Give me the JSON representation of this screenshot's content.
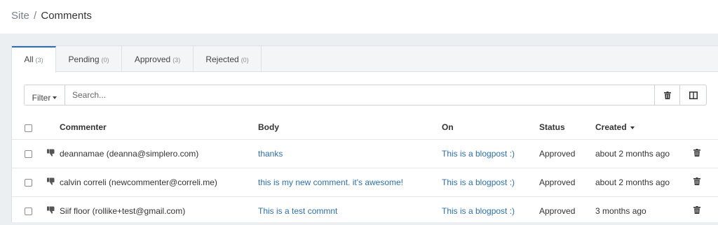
{
  "breadcrumb": {
    "site": "Site",
    "separator": "/",
    "current": "Comments"
  },
  "tabs": [
    {
      "label": "All",
      "count": "(3)",
      "active": true
    },
    {
      "label": "Pending",
      "count": "(0)",
      "active": false
    },
    {
      "label": "Approved",
      "count": "(3)",
      "active": false
    },
    {
      "label": "Rejected",
      "count": "(0)",
      "active": false
    }
  ],
  "toolbar": {
    "filter_label": "Filter",
    "search_placeholder": "Search..."
  },
  "table": {
    "headers": {
      "commenter": "Commenter",
      "body": "Body",
      "on": "On",
      "status": "Status",
      "created": "Created"
    },
    "rows": [
      {
        "commenter": "deannamae (deanna@simplero.com)",
        "body": "thanks",
        "on": "This is a blogpost :)",
        "status": "Approved",
        "created": "about 2 months ago"
      },
      {
        "commenter": "calvin correli (newcommenter@correli.me)",
        "body": "this is my new comment. it's awesome!",
        "on": "This is a blogpost :)",
        "status": "Approved",
        "created": "about 2 months ago"
      },
      {
        "commenter": "Siif floor (rollike+test@gmail.com)",
        "body": "This is a test commnt",
        "on": "This is a blogpost :)",
        "status": "Approved",
        "created": "3 months ago"
      }
    ]
  },
  "colors": {
    "link": "#2a6fb5",
    "active_tab_border": "#2a6fb5",
    "background": "#eceff2"
  }
}
